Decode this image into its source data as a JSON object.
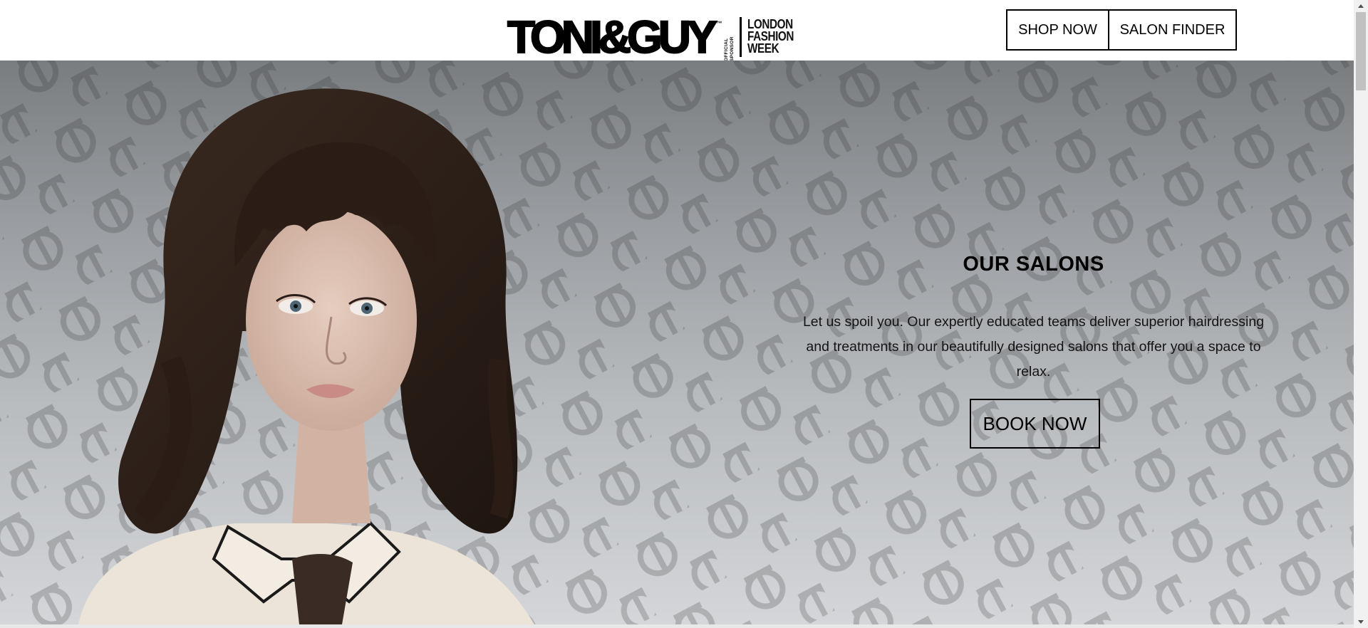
{
  "header": {
    "logo_text": "TONI&GUY",
    "logo_tm": "™",
    "logo_sponsor": "OFFICIAL SPONSOR",
    "logo_event_lines": [
      "LONDON",
      "FASHION",
      "WEEK"
    ],
    "nav": {
      "shop_label": "SHOP NOW",
      "finder_label": "SALON FINDER"
    }
  },
  "hero": {
    "title": "OUR SALONS",
    "description": "Let us spoil you. Our expertly educated teams deliver superior hairdressing and treatments in our beautifully designed salons that offer you a space to relax.",
    "book_label": "BOOK NOW",
    "pattern_monogram": "TG",
    "colors": {
      "gradient_top": "#7a7d80",
      "gradient_bottom": "#d4d6d9",
      "hair": "#2b1d16",
      "skin": "#dcc1b3",
      "blouse": "#ece4d8"
    }
  },
  "icons": {
    "scroll_up": "arrow-up-icon",
    "scroll_down": "arrow-down-icon"
  }
}
